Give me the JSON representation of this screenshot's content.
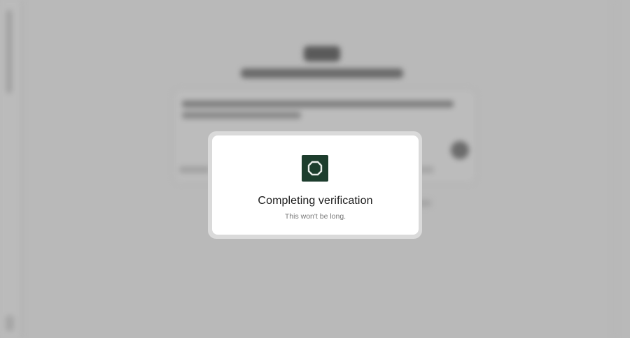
{
  "modal": {
    "title": "Completing verification",
    "subtitle": "This won't be long.",
    "icon": "verification-shield-icon"
  },
  "colors": {
    "icon_background": "#1d3d2d",
    "overlay": "#b9b9b9"
  }
}
